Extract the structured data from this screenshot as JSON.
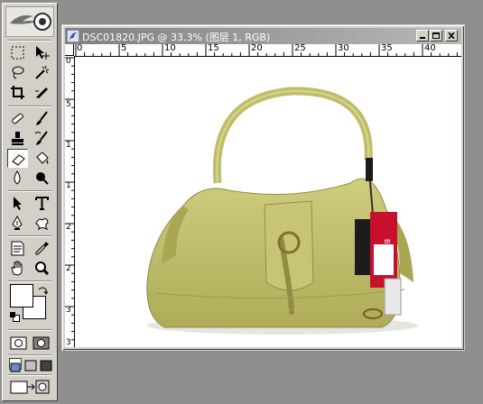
{
  "document": {
    "title": "DSC01820.JPG @ 33.3% (图层 1, RGB)"
  },
  "rulers": {
    "horizontal_labels": [
      "0",
      "5",
      "10",
      "15",
      "20",
      "25",
      "30",
      "35",
      "40"
    ],
    "vertical_labels": [
      "0",
      "5",
      "1",
      "1",
      "2",
      "2",
      "3",
      "3"
    ]
  },
  "tools": {
    "rows": [
      [
        "marquee-icon",
        "move-icon"
      ],
      [
        "lasso-icon",
        "magic-wand-icon"
      ],
      [
        "crop-icon",
        "slice-icon"
      ],
      [
        "healing-brush-icon",
        "brush-icon"
      ],
      [
        "clone-stamp-icon",
        "history-brush-icon"
      ],
      [
        "eraser-icon",
        "paint-bucket-icon"
      ],
      [
        "blur-icon",
        "dodge-icon"
      ],
      [
        "path-select-icon",
        "type-icon"
      ],
      [
        "pen-icon",
        "custom-shape-icon"
      ],
      [
        "notes-icon",
        "eyedropper-icon"
      ],
      [
        "hand-icon",
        "zoom-icon"
      ]
    ],
    "active": "eraser-icon"
  },
  "colors": {
    "foreground": "#ffffff",
    "background": "#ffffff",
    "workspace": "#8e8e8e",
    "title_bar": "#9a9a9a",
    "bag": "#bdbc6a"
  },
  "product_tag": {
    "brand": "BOSSCO"
  }
}
